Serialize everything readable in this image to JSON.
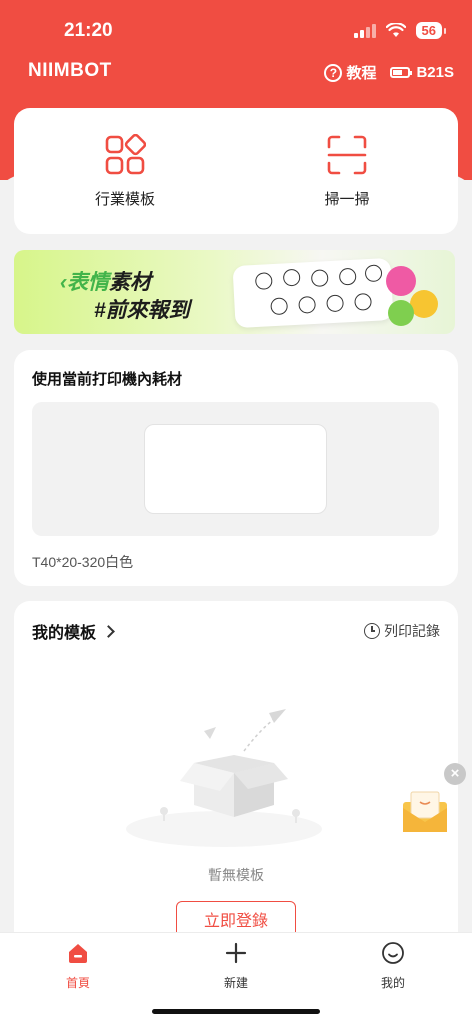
{
  "status_bar": {
    "time": "21:20",
    "battery": "56"
  },
  "header": {
    "brand": "NIIMBOT",
    "help_label": "教程",
    "device_name": "B21S"
  },
  "actions": [
    {
      "label": "行業模板",
      "icon": "template-grid-icon"
    },
    {
      "label": "掃一掃",
      "icon": "scan-icon"
    }
  ],
  "banner": {
    "line1_a": "‹表情",
    "line1_b": "素材",
    "line2": "#前來報到"
  },
  "consumable": {
    "title": "使用當前打印機內耗材",
    "label_name": "T40*20-320白色"
  },
  "templates": {
    "title": "我的模板",
    "history_label": "列印記錄",
    "empty_text": "暫無模板",
    "register_button": "立即登錄"
  },
  "float": {
    "close_symbol": "×"
  },
  "tab_bar": {
    "home": "首頁",
    "new": "新建",
    "me": "我的"
  },
  "colors": {
    "accent": "#f04d42",
    "background": "#f2f2f2"
  }
}
